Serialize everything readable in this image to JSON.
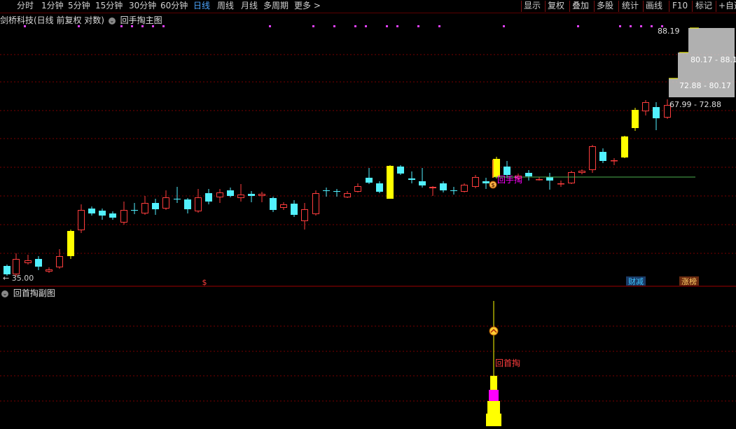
{
  "toolbar": {
    "left_items": [
      {
        "label": "分时",
        "active": false
      },
      {
        "label": "1分钟",
        "active": false
      },
      {
        "label": "5分钟",
        "active": false
      },
      {
        "label": "15分钟",
        "active": false
      },
      {
        "label": "30分钟",
        "active": false
      },
      {
        "label": "60分钟",
        "active": false
      },
      {
        "label": "日线",
        "active": true
      },
      {
        "label": "周线",
        "active": false
      },
      {
        "label": "月线",
        "active": false
      },
      {
        "label": "多周期",
        "active": false
      },
      {
        "label": "更多",
        "active": false
      }
    ],
    "more_arrow": ">",
    "right_items": [
      "显示",
      "复权",
      "叠加",
      "多股",
      "统计",
      "画线",
      "F10",
      "标记",
      "+自选"
    ]
  },
  "main_chart": {
    "stock_label": "剑桥科技(日线 前复权 对数)",
    "indicator_label": "回手掏主图",
    "price_low_label": "35.00",
    "price_low_arrow": "←",
    "marker_label": "回手掏",
    "marker_icon_char": "$",
    "bottom_marker_char": "$",
    "event_tags": [
      {
        "text": "财减",
        "color": "#3ec6ff",
        "bg": "#1a3a66"
      },
      {
        "text": "涨榜",
        "color": "#ffcc66",
        "bg": "#6a2a10"
      }
    ],
    "price_ranges": [
      {
        "top_price": "88.19",
        "label": "80.17 - 88.1",
        "fill": 0.85
      },
      {
        "label": "72.88 - 80.17",
        "fill": 1.0
      },
      {
        "label": "67.99 - 72.88",
        "fill": 0.0
      }
    ]
  },
  "sub_chart": {
    "indicator_label": "回首掏副图",
    "signal_label": "回首掏"
  },
  "colors": {
    "up": "#ff3d3d",
    "down": "#52f1ff",
    "yellow": "#ffff00",
    "magenta": "#ff00ff",
    "grid": "#7a0000",
    "support_line": "#4caf50",
    "dots": "#e040fb"
  }
}
